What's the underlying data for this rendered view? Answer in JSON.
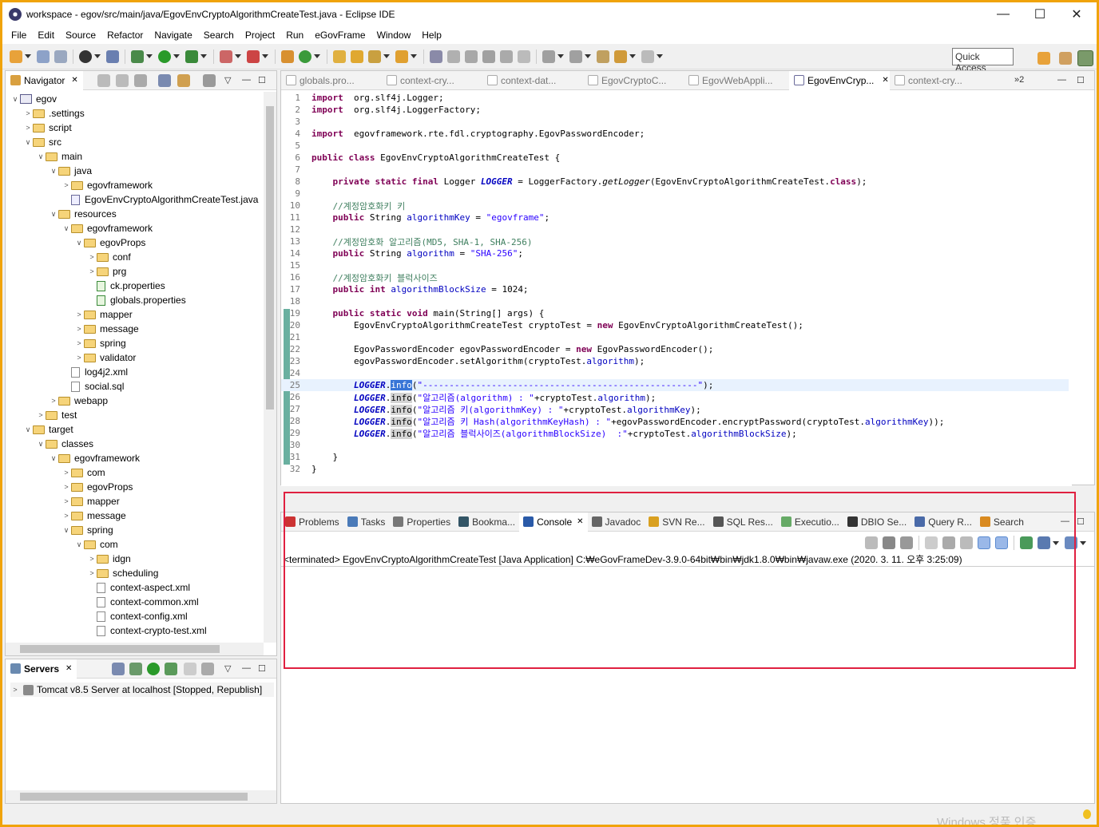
{
  "window": {
    "title": "workspace - egov/src/main/java/EgovEnvCryptoAlgorithmCreateTest.java - Eclipse IDE"
  },
  "menu": [
    "File",
    "Edit",
    "Source",
    "Refactor",
    "Navigate",
    "Search",
    "Project",
    "Run",
    "eGovFrame",
    "Window",
    "Help"
  ],
  "quick_access": "Quick Access",
  "navigator": {
    "tab_label": "Navigator",
    "tree": [
      {
        "label": "egov",
        "depth": 0,
        "kind": "project",
        "twisty": "v"
      },
      {
        "label": ".settings",
        "depth": 1,
        "kind": "folder",
        "twisty": ">"
      },
      {
        "label": "script",
        "depth": 1,
        "kind": "folder",
        "twisty": ">"
      },
      {
        "label": "src",
        "depth": 1,
        "kind": "folder",
        "twisty": "v"
      },
      {
        "label": "main",
        "depth": 2,
        "kind": "folder",
        "twisty": "v"
      },
      {
        "label": "java",
        "depth": 3,
        "kind": "folder",
        "twisty": "v"
      },
      {
        "label": "egovframework",
        "depth": 4,
        "kind": "folder",
        "twisty": ">"
      },
      {
        "label": "EgovEnvCryptoAlgorithmCreateTest.java",
        "depth": 4,
        "kind": "java",
        "twisty": ""
      },
      {
        "label": "resources",
        "depth": 3,
        "kind": "folder",
        "twisty": "v"
      },
      {
        "label": "egovframework",
        "depth": 4,
        "kind": "folder",
        "twisty": "v"
      },
      {
        "label": "egovProps",
        "depth": 5,
        "kind": "folder",
        "twisty": "v"
      },
      {
        "label": "conf",
        "depth": 6,
        "kind": "folder",
        "twisty": ">"
      },
      {
        "label": "prg",
        "depth": 6,
        "kind": "folder",
        "twisty": ">"
      },
      {
        "label": "ck.properties",
        "depth": 6,
        "kind": "props",
        "twisty": ""
      },
      {
        "label": "globals.properties",
        "depth": 6,
        "kind": "props",
        "twisty": ""
      },
      {
        "label": "mapper",
        "depth": 5,
        "kind": "folder",
        "twisty": ">"
      },
      {
        "label": "message",
        "depth": 5,
        "kind": "folder",
        "twisty": ">"
      },
      {
        "label": "spring",
        "depth": 5,
        "kind": "folder",
        "twisty": ">"
      },
      {
        "label": "validator",
        "depth": 5,
        "kind": "folder",
        "twisty": ">"
      },
      {
        "label": "log4j2.xml",
        "depth": 4,
        "kind": "file",
        "twisty": ""
      },
      {
        "label": "social.sql",
        "depth": 4,
        "kind": "file",
        "twisty": ""
      },
      {
        "label": "webapp",
        "depth": 3,
        "kind": "folder",
        "twisty": ">"
      },
      {
        "label": "test",
        "depth": 2,
        "kind": "folder",
        "twisty": ">"
      },
      {
        "label": "target",
        "depth": 1,
        "kind": "folder",
        "twisty": "v"
      },
      {
        "label": "classes",
        "depth": 2,
        "kind": "folder",
        "twisty": "v"
      },
      {
        "label": "egovframework",
        "depth": 3,
        "kind": "folder",
        "twisty": "v"
      },
      {
        "label": "com",
        "depth": 4,
        "kind": "folder",
        "twisty": ">"
      },
      {
        "label": "egovProps",
        "depth": 4,
        "kind": "folder",
        "twisty": ">"
      },
      {
        "label": "mapper",
        "depth": 4,
        "kind": "folder",
        "twisty": ">"
      },
      {
        "label": "message",
        "depth": 4,
        "kind": "folder",
        "twisty": ">"
      },
      {
        "label": "spring",
        "depth": 4,
        "kind": "folder",
        "twisty": "v"
      },
      {
        "label": "com",
        "depth": 5,
        "kind": "folder",
        "twisty": "v"
      },
      {
        "label": "idgn",
        "depth": 6,
        "kind": "folder",
        "twisty": ">"
      },
      {
        "label": "scheduling",
        "depth": 6,
        "kind": "folder",
        "twisty": ">"
      },
      {
        "label": "context-aspect.xml",
        "depth": 6,
        "kind": "file",
        "twisty": ""
      },
      {
        "label": "context-common.xml",
        "depth": 6,
        "kind": "file",
        "twisty": ""
      },
      {
        "label": "context-config.xml",
        "depth": 6,
        "kind": "file",
        "twisty": ""
      },
      {
        "label": "context-crypto-test.xml",
        "depth": 6,
        "kind": "file",
        "twisty": ""
      }
    ]
  },
  "servers": {
    "tab_label": "Servers",
    "items": [
      "Tomcat v8.5 Server at localhost  [Stopped, Republish]"
    ]
  },
  "editor": {
    "tabs": [
      {
        "label": "globals.pro...",
        "active": false
      },
      {
        "label": "context-cry...",
        "active": false
      },
      {
        "label": "context-dat...",
        "active": false
      },
      {
        "label": "EgovCryptoC...",
        "active": false
      },
      {
        "label": "EgovWebAppli...",
        "active": false
      },
      {
        "label": "EgovEnvCryp...",
        "active": true
      },
      {
        "label": "context-cry...",
        "active": false
      }
    ],
    "overflow": "»2",
    "lines": [
      [
        [
          "kw",
          "import"
        ],
        [
          "",
          "  org.slf4j.Logger;"
        ]
      ],
      [
        [
          "kw",
          "import"
        ],
        [
          "",
          "  org.slf4j.LoggerFactory;"
        ]
      ],
      [],
      [
        [
          "kw",
          "import"
        ],
        [
          "",
          "  egovframework.rte.fdl.cryptography.EgovPasswordEncoder;"
        ]
      ],
      [],
      [
        [
          "kw",
          "public class"
        ],
        [
          "",
          " EgovEnvCryptoAlgorithmCreateTest {"
        ]
      ],
      [],
      [
        [
          "",
          "    "
        ],
        [
          "kw",
          "private static final"
        ],
        [
          "",
          " Logger "
        ],
        [
          "sf",
          "LOGGER"
        ],
        [
          "",
          " = LoggerFactory."
        ],
        [
          "it",
          "getLogger"
        ],
        [
          "",
          "(EgovEnvCryptoAlgorithmCreateTest."
        ],
        [
          "kw",
          "class"
        ],
        [
          "",
          ");"
        ]
      ],
      [],
      [
        [
          "",
          "    "
        ],
        [
          "cm",
          "//계정암호화키 키"
        ]
      ],
      [
        [
          "",
          "    "
        ],
        [
          "kw",
          "public"
        ],
        [
          "",
          " String "
        ],
        [
          "fi",
          "algorithmKey"
        ],
        [
          "",
          " = "
        ],
        [
          "st",
          "\"egovframe\""
        ],
        [
          "",
          ";"
        ]
      ],
      [],
      [
        [
          "",
          "    "
        ],
        [
          "cm",
          "//계정암호화 알고리즘(MD5, SHA-1, SHA-256)"
        ]
      ],
      [
        [
          "",
          "    "
        ],
        [
          "kw",
          "public"
        ],
        [
          "",
          " String "
        ],
        [
          "fi",
          "algorithm"
        ],
        [
          "",
          " = "
        ],
        [
          "st",
          "\"SHA-256\""
        ],
        [
          "",
          ";"
        ]
      ],
      [],
      [
        [
          "",
          "    "
        ],
        [
          "cm",
          "//계정암호화키 블럭사이즈"
        ]
      ],
      [
        [
          "",
          "    "
        ],
        [
          "kw",
          "public int"
        ],
        [
          "",
          " "
        ],
        [
          "fi",
          "algorithmBlockSize"
        ],
        [
          "",
          " = 1024;"
        ]
      ],
      [],
      [
        [
          "",
          "    "
        ],
        [
          "kw",
          "public static void"
        ],
        [
          "",
          " main(String[] args) {"
        ]
      ],
      [
        [
          "",
          "        EgovEnvCryptoAlgorithmCreateTest cryptoTest = "
        ],
        [
          "kw",
          "new"
        ],
        [
          "",
          " EgovEnvCryptoAlgorithmCreateTest();"
        ]
      ],
      [],
      [
        [
          "",
          "        EgovPasswordEncoder egovPasswordEncoder = "
        ],
        [
          "kw",
          "new"
        ],
        [
          "",
          " EgovPasswordEncoder();"
        ]
      ],
      [
        [
          "",
          "        egovPasswordEncoder.setAlgorithm(cryptoTest."
        ],
        [
          "fi",
          "algorithm"
        ],
        [
          "",
          ");"
        ]
      ],
      [],
      [
        [
          "",
          "        "
        ],
        [
          "sf",
          "LOGGER"
        ],
        [
          "",
          "."
        ],
        [
          "ocsel",
          "info"
        ],
        [
          "",
          "("
        ],
        [
          "st",
          "\"----------------------------------------------------\""
        ],
        [
          "",
          ");"
        ]
      ],
      [
        [
          "",
          "        "
        ],
        [
          "sf",
          "LOGGER"
        ],
        [
          "",
          "."
        ],
        [
          "occ",
          "info"
        ],
        [
          "",
          "("
        ],
        [
          "st",
          "\"알고리즘(algorithm) : \""
        ],
        [
          "",
          "+cryptoTest."
        ],
        [
          "fi",
          "algorithm"
        ],
        [
          "",
          ");"
        ]
      ],
      [
        [
          "",
          "        "
        ],
        [
          "sf",
          "LOGGER"
        ],
        [
          "",
          "."
        ],
        [
          "occ",
          "info"
        ],
        [
          "",
          "("
        ],
        [
          "st",
          "\"알고리즘 키(algorithmKey) : \""
        ],
        [
          "",
          "+cryptoTest."
        ],
        [
          "fi",
          "algorithmKey"
        ],
        [
          "",
          ");"
        ]
      ],
      [
        [
          "",
          "        "
        ],
        [
          "sf",
          "LOGGER"
        ],
        [
          "",
          "."
        ],
        [
          "occ",
          "info"
        ],
        [
          "",
          "("
        ],
        [
          "st",
          "\"알고리즘 키 Hash(algorithmKeyHash) : \""
        ],
        [
          "",
          "+egovPasswordEncoder.encryptPassword(cryptoTest."
        ],
        [
          "fi",
          "algorithmKey"
        ],
        [
          "",
          "));"
        ]
      ],
      [
        [
          "",
          "        "
        ],
        [
          "sf",
          "LOGGER"
        ],
        [
          "",
          "."
        ],
        [
          "occ",
          "info"
        ],
        [
          "",
          "("
        ],
        [
          "st",
          "\"알고리즘 블럭사이즈(algorithmBlockSize)  :\""
        ],
        [
          "",
          "+cryptoTest."
        ],
        [
          "fi",
          "algorithmBlockSize"
        ],
        [
          "",
          ");"
        ]
      ],
      [],
      [
        [
          "",
          "    }"
        ]
      ],
      [
        [
          "",
          "}"
        ]
      ]
    ]
  },
  "bottom": {
    "tabs": [
      {
        "label": "Problems",
        "active": false,
        "color": "#c33"
      },
      {
        "label": "Tasks",
        "active": false,
        "color": "#4a7ab8"
      },
      {
        "label": "Properties",
        "active": false,
        "color": "#777"
      },
      {
        "label": "Bookma...",
        "active": false,
        "color": "#356"
      },
      {
        "label": "Console",
        "active": true,
        "color": "#2a5aa8"
      },
      {
        "label": "Javadoc",
        "active": false,
        "color": "#666"
      },
      {
        "label": "SVN Re...",
        "active": false,
        "color": "#d9a020"
      },
      {
        "label": "SQL Res...",
        "active": false,
        "color": "#555"
      },
      {
        "label": "Executio...",
        "active": false,
        "color": "#6a6"
      },
      {
        "label": "DBIO Se...",
        "active": false,
        "color": "#333"
      },
      {
        "label": "Query R...",
        "active": false,
        "color": "#4a6aa8"
      },
      {
        "label": "Search",
        "active": false,
        "color": "#d98a20"
      }
    ],
    "console_header": "<terminated> EgovEnvCryptoAlgorithmCreateTest [Java Application] C:₩eGovFrameDev-3.9.0-64bit₩bin₩jdk1.8.0₩bin₩javaw.exe (2020. 3. 11. 오후 3:25:09)"
  },
  "taskbar_watermark": "Windows 정품 인증"
}
